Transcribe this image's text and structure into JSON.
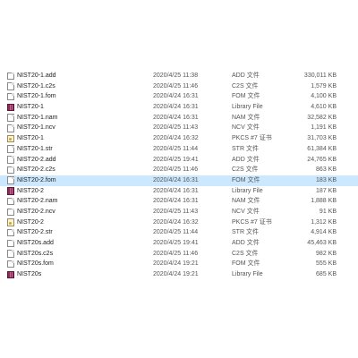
{
  "files": [
    {
      "name": "NIST20-1.add",
      "date": "2020/4/25 11:38",
      "type": "ADD 文件",
      "size": "330,011 KB",
      "icon": "document-icon"
    },
    {
      "name": "NIST20-1.c2s",
      "date": "2020/4/25 11:46",
      "type": "C2S 文件",
      "size": "1,579 KB",
      "icon": "document-icon"
    },
    {
      "name": "NIST20-1.fom",
      "date": "2020/4/24 16:31",
      "type": "FOM 文件",
      "size": "4,100 KB",
      "icon": "document-icon"
    },
    {
      "name": "NIST20-1",
      "date": "2020/4/24 16:31",
      "type": "Library File",
      "size": "4,610 KB",
      "icon": "library-icon"
    },
    {
      "name": "NIST20-1.nam",
      "date": "2020/4/24 16:31",
      "type": "NAM 文件",
      "size": "32,582 KB",
      "icon": "document-icon"
    },
    {
      "name": "NIST20-1.ncv",
      "date": "2020/4/25 11:43",
      "type": "NCV 文件",
      "size": "1,191 KB",
      "icon": "document-icon"
    },
    {
      "name": "NIST20-1",
      "date": "2020/4/24 16:32",
      "type": "PKCS #7 证书",
      "size": "31,703 KB",
      "icon": "certificate-icon"
    },
    {
      "name": "NIST20-1.str",
      "date": "2020/4/25 11:44",
      "type": "STR 文件",
      "size": "61,384 KB",
      "icon": "document-icon"
    },
    {
      "name": "NIST20-2.add",
      "date": "2020/4/25 19:41",
      "type": "ADD 文件",
      "size": "24,765 KB",
      "icon": "document-icon"
    },
    {
      "name": "NIST20-2.c2s",
      "date": "2020/4/25 11:46",
      "type": "C2S 文件",
      "size": "863 KB",
      "icon": "document-icon"
    },
    {
      "name": "NIST20-2.fom",
      "date": "2020/4/24 16:31",
      "type": "FOM 文件",
      "size": "183 KB",
      "icon": "document-icon",
      "selected": true
    },
    {
      "name": "NIST20-2",
      "date": "2020/4/24 16:31",
      "type": "Library File",
      "size": "187 KB",
      "icon": "library-icon"
    },
    {
      "name": "NIST20-2.nam",
      "date": "2020/4/24 16:31",
      "type": "NAM 文件",
      "size": "1,888 KB",
      "icon": "document-icon"
    },
    {
      "name": "NIST20-2.ncv",
      "date": "2020/4/25 11:43",
      "type": "NCV 文件",
      "size": "91 KB",
      "icon": "document-icon"
    },
    {
      "name": "NIST20-2",
      "date": "2020/4/24 16:32",
      "type": "PKCS #7 证书",
      "size": "1,312 KB",
      "icon": "certificate-icon"
    },
    {
      "name": "NIST20-2.str",
      "date": "2020/4/25 11:44",
      "type": "STR 文件",
      "size": "4,914 KB",
      "icon": "document-icon"
    },
    {
      "name": "NIST20s.add",
      "date": "2020/4/25 19:41",
      "type": "ADD 文件",
      "size": "45,463 KB",
      "icon": "document-icon"
    },
    {
      "name": "NIST20s.c2s",
      "date": "2020/4/25 11:46",
      "type": "C2S 文件",
      "size": "982 KB",
      "icon": "document-icon"
    },
    {
      "name": "NIST20s.fom",
      "date": "2020/4/24 19:21",
      "type": "FOM 文件",
      "size": "555 KB",
      "icon": "document-icon"
    },
    {
      "name": "NIST20s",
      "date": "2020/4/24 19:21",
      "type": "Library File",
      "size": "685 KB",
      "icon": "library-icon"
    }
  ],
  "colors": {
    "selected_row": "#cce8ff",
    "library_icon": "#8b2b5a",
    "certificate_icon": "#d9a21b"
  }
}
